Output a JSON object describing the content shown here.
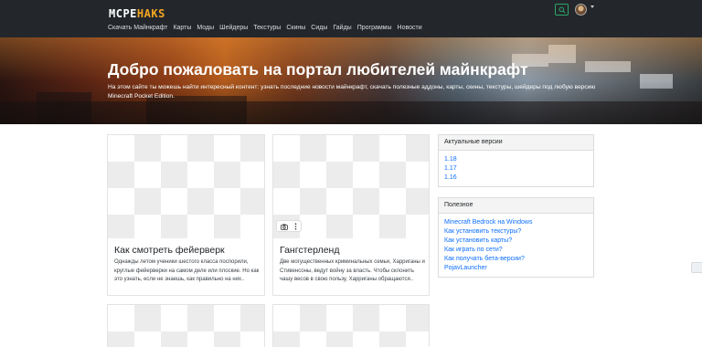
{
  "header": {
    "logo_main": "MCPE",
    "logo_accent": "HAKS",
    "menu": [
      "Скачать Майнкрафт",
      "Карты",
      "Моды",
      "Шейдеры",
      "Текстуры",
      "Скины",
      "Сиды",
      "Гайды",
      "Программы",
      "Новости"
    ]
  },
  "hero": {
    "title": "Добро пожаловать на портал любителей майнкрафт",
    "text": "На этом сайте ты можешь найти интересный контент: узнать последние новости майнкрафт, скачать полезные аддоны, карты, скины, текстуры, шейдеры под любую версию Minecraft Pocket Edition."
  },
  "cards": [
    {
      "title": "Как смотреть фейерверк",
      "text": "Однажды летом ученики шестого класса поспорили, круглые фейерверки на самом деле или плоские. Но как это узнать, если не знаешь, как правильно на них.."
    },
    {
      "title": "Гангстерленд",
      "text": "Две могущественных криминальных семьи, Харриганы и Стивенсоны, ведут войну за власть. Чтобы склонить чашу весов в свою пользу, Харриганы обращаются.."
    }
  ],
  "sidebar": {
    "versions": {
      "title": "Актуальные версии",
      "links": [
        "1.18",
        "1.17",
        "1.16"
      ]
    },
    "useful": {
      "title": "Полезное",
      "links": [
        "Minecraft Bedrock на Windows",
        "Как установить текстуры?",
        "Как установить карты?",
        "Как играть по сети?",
        "Как получать бета-версии?",
        "PojavLauncher"
      ]
    }
  },
  "icons": {
    "search": "search-icon",
    "camera": "camera-icon",
    "more": "more-vertical-icon"
  },
  "colors": {
    "nav_bg": "#23272b",
    "link": "#0d6efd",
    "search_border": "#2fa46a",
    "logo_accent": "#f5a623"
  }
}
